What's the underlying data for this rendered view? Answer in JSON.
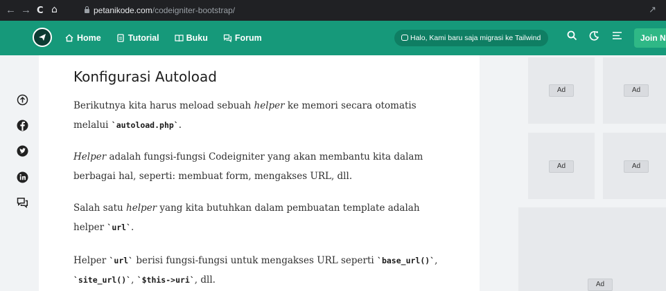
{
  "browser": {
    "url_host": "petanikode.com",
    "url_path": "/codeigniter-bootstrap/"
  },
  "header": {
    "menu": [
      {
        "label": "Home",
        "icon": "home-icon"
      },
      {
        "label": "Tutorial",
        "icon": "document-icon"
      },
      {
        "label": "Buku",
        "icon": "book-icon"
      },
      {
        "label": "Forum",
        "icon": "chat-icon"
      }
    ],
    "announcement": "Halo, Kami baru saja migrasi ke Tailwind",
    "join_label": "Join N",
    "brand_color": "#16997a"
  },
  "social": [
    "arrow-up-icon",
    "facebook-icon",
    "twitter-icon",
    "linkedin-icon",
    "comment-icon"
  ],
  "article": {
    "heading": "Konfigurasi Autoload",
    "p1_a": "Berikutnya kita harus meload sebuah ",
    "p1_em": "helper",
    "p1_b": " ke memori secara otomatis",
    "p1_c": "melalui ",
    "p1_code": "`autoload.php`",
    "p1_d": ".",
    "p2_em": "Helper",
    "p2_a": " adalah fungsi-fungsi Codeigniter yang akan membantu kita dalam",
    "p2_b": "berbagai hal, seperti: membuat form, mengakses URL, dll.",
    "p3_a": "Salah satu ",
    "p3_em": "helper",
    "p3_b": " yang kita butuhkan dalam pembuatan template adalah",
    "p3_c": "helper ",
    "p3_code": "`url`",
    "p3_d": ".",
    "p4_a": "Helper ",
    "p4_code1": "`url`",
    "p4_b": " berisi fungsi-fungsi untuk mengakses URL seperti ",
    "p4_code2": "`base_url()`",
    "p4_c": ",",
    "p4_code3": "`site_url()`",
    "p4_d": ", ",
    "p4_code4": "`$this->uri`",
    "p4_e": ", dll."
  },
  "ads": {
    "label": "Ad"
  }
}
